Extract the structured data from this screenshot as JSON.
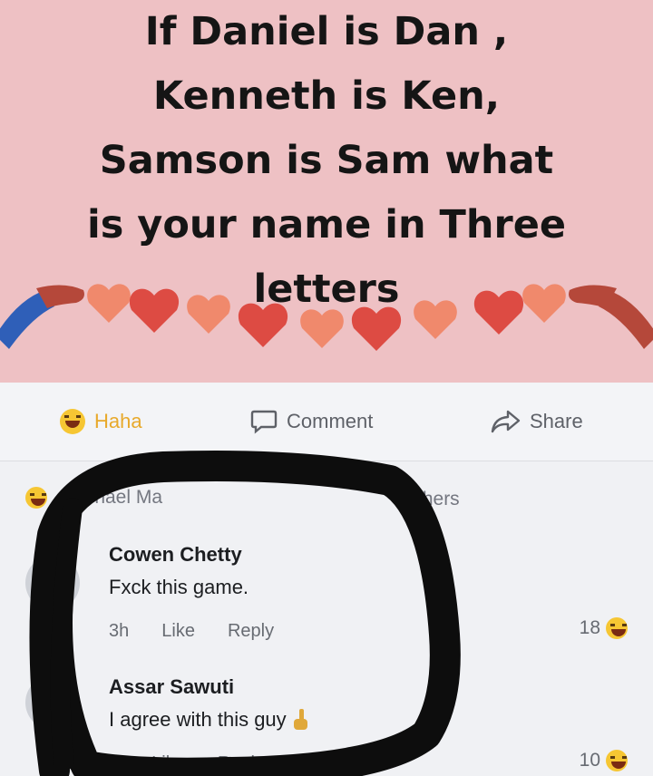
{
  "post_image": {
    "headline_lines": [
      "If Daniel is Dan ,",
      "Kenneth is Ken,",
      "Samson is Sam what",
      "is your name in Three",
      "letters"
    ]
  },
  "actions": {
    "haha": "Haha",
    "comment": "Comment",
    "share": "Share"
  },
  "reactors_text": ", Michael Ma",
  "reactors_suffix": "thers",
  "comments": [
    {
      "name": "Cowen Chetty",
      "text": "Fxck this game.",
      "time": "3h",
      "like": "Like",
      "reply": "Reply",
      "reaction_count": "18"
    },
    {
      "name": "Assar Sawuti",
      "text": "I agree with this guy",
      "time": "h",
      "like": "Like",
      "reply": "Reply",
      "reaction_count": "10"
    }
  ],
  "colors": {
    "banner_pink": "#eec1c4",
    "haha_yellow": "#f6c633",
    "scribble": "#0d0d0d"
  }
}
